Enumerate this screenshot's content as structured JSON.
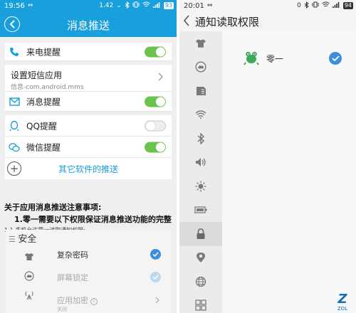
{
  "left": {
    "status": {
      "time": "19:56",
      "usb": "⇔",
      "speed": "1.42",
      "speed_unit": "⌄",
      "battery": "93"
    },
    "header": {
      "title": "消息推送"
    },
    "rows": {
      "call": {
        "label": "来电提醒",
        "on": true
      },
      "sms": {
        "title": "设置短信应用",
        "subtitle": "信息-com.android.mms"
      },
      "message": {
        "label": "消息提醒",
        "on": true
      },
      "qq": {
        "label": "QQ提醒",
        "on": false
      },
      "wechat": {
        "label": "微信提醒",
        "on": true
      },
      "other": {
        "label": "其它软件的推送"
      }
    },
    "notice": {
      "heading": "关于应用消息推送注意事项:",
      "item1": "1.零一需要以下权限保证消息推送功能的完整",
      "item1_1": "1.1 手机允许零一读取通知权限;"
    },
    "embedded": {
      "title": "安全",
      "items": [
        {
          "title": "复杂密码",
          "checked": true
        },
        {
          "title": "屏幕锁定",
          "checked": true
        },
        {
          "title": "应用加密",
          "subtitle": "关闭"
        }
      ]
    }
  },
  "right": {
    "status": {
      "time": "20:01",
      "usb": "⇔",
      "speed": "0",
      "battery": "94"
    },
    "header": {
      "title": "通知读取权限"
    },
    "apps": [
      {
        "name": "零一",
        "checked": true
      }
    ],
    "sidebar_icons": [
      "shirt-icon",
      "cloud-icon",
      "sim-icon",
      "wifi-icon",
      "bluetooth-icon",
      "volume-icon",
      "brightness-icon",
      "battery-icon",
      "lock-icon",
      "location-icon",
      "globe-icon",
      "grid-icon"
    ]
  },
  "colors": {
    "accent": "#1a9fdd",
    "toggle_on": "#6cc24a",
    "check": "#3d8fdc"
  }
}
